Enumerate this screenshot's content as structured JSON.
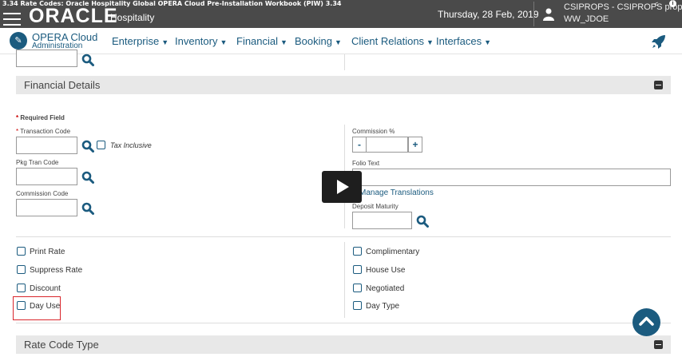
{
  "video_title": "3.34 Rate Codes: Oracle Hospitality Global OPERA Cloud Pre-Installation Workbook (PIW) 3.34",
  "header": {
    "logo": "ORACLE",
    "logo_sub": "Hospitality",
    "date": "Thursday, 28 Feb, 2019",
    "user_name": "CSIPROPS - CSIPROPS property",
    "user_login": "WW_JDOE"
  },
  "nav": {
    "app_title": "OPERA Cloud",
    "app_subtitle": "Administration",
    "items": [
      {
        "label": "Enterprise"
      },
      {
        "label": "Inventory"
      },
      {
        "label": "Financial"
      },
      {
        "label": "Booking"
      },
      {
        "label": "Client Relations"
      },
      {
        "label": "Interfaces"
      }
    ]
  },
  "financial_details": {
    "title": "Financial Details",
    "required_field": "Required Field",
    "transaction_code_label": "Transaction Code",
    "tax_inclusive_label": "Tax Inclusive",
    "pkg_tran_code_label": "Pkg Tran Code",
    "commission_code_label": "Commission Code",
    "commission_pct_label": "Commission %",
    "folio_text_label": "Folio Text",
    "manage_translations_label": "Manage Translations",
    "deposit_maturity_label": "Deposit Maturity",
    "stepper_minus": "-",
    "stepper_plus": "+",
    "left_checkboxes": [
      {
        "label": "Print Rate"
      },
      {
        "label": "Suppress Rate"
      },
      {
        "label": "Discount"
      },
      {
        "label": "Day Use"
      }
    ],
    "right_checkboxes": [
      {
        "label": "Complimentary"
      },
      {
        "label": "House Use"
      },
      {
        "label": "Negotiated"
      },
      {
        "label": "Day Type"
      }
    ]
  },
  "rate_code_type": {
    "title": "Rate Code Type"
  },
  "colors": {
    "brand": "#1b5b7f",
    "highlight": "#d9262c"
  }
}
